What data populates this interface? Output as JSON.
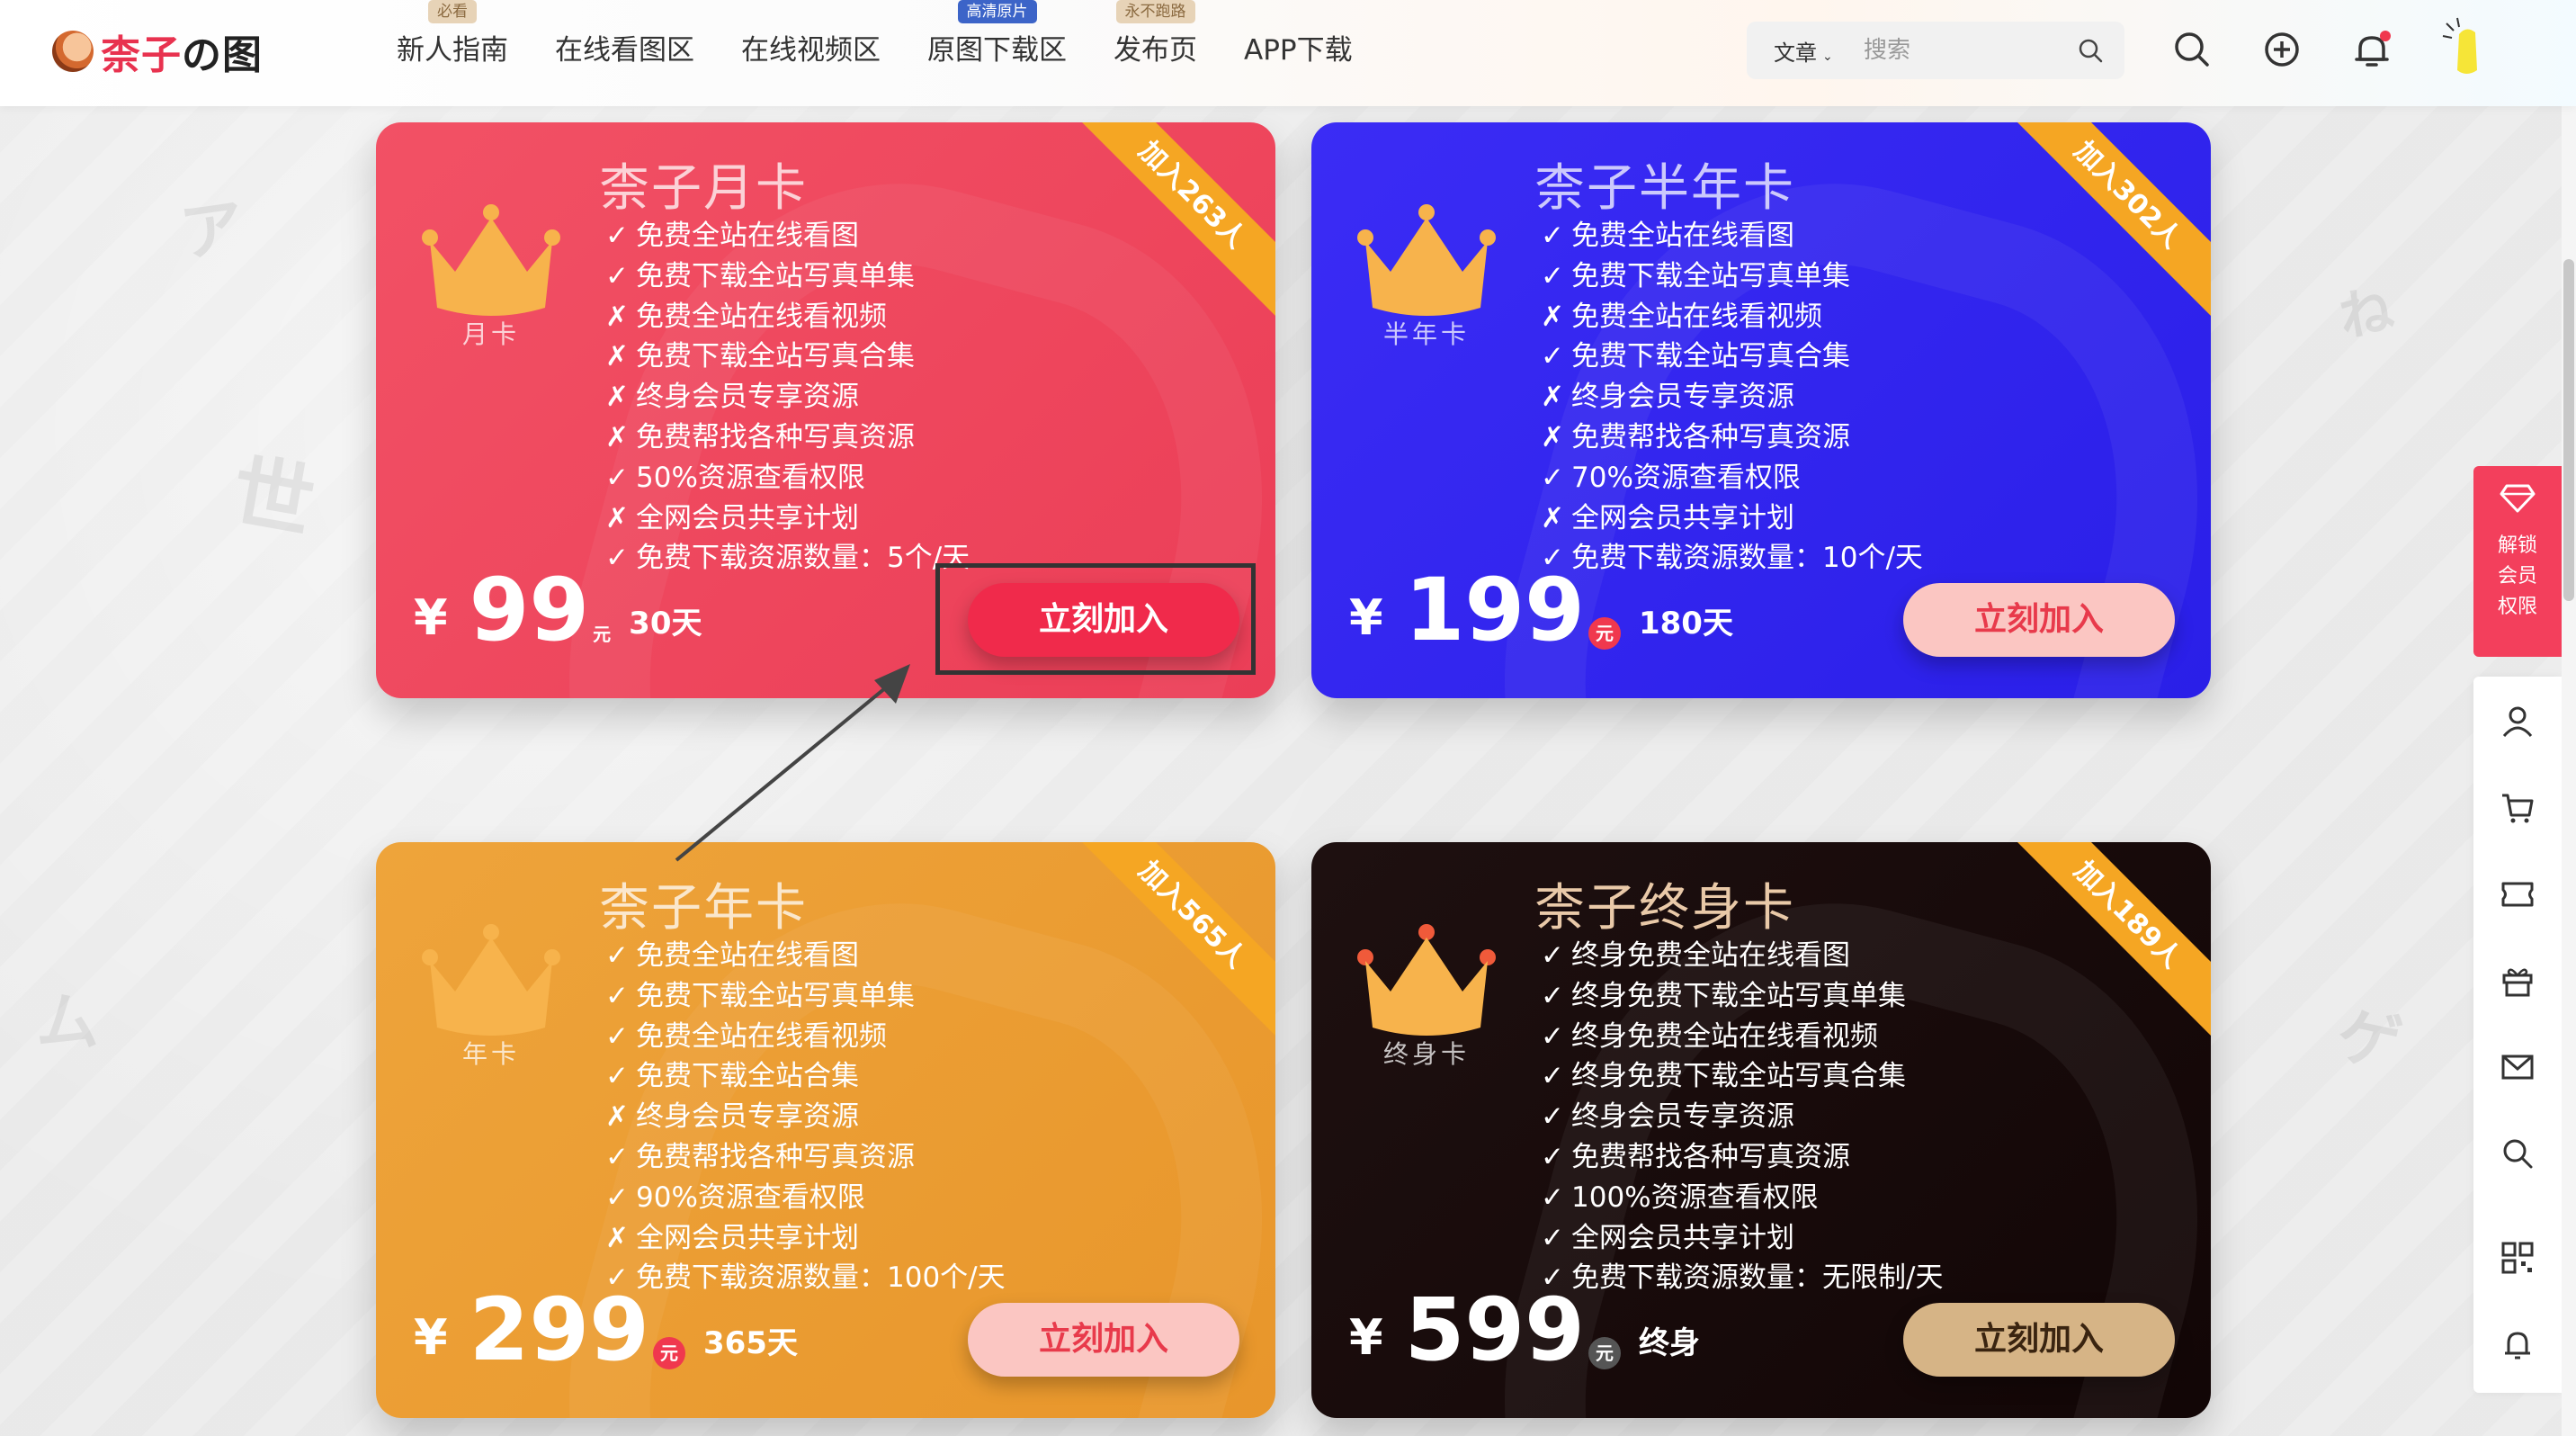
{
  "header": {
    "logo_text_red": "柰子",
    "logo_text_dark": "の图",
    "nav": [
      {
        "label": "新人指南",
        "badge": "必看",
        "badge_style": "tan"
      },
      {
        "label": "在线看图区",
        "badge": "",
        "badge_style": ""
      },
      {
        "label": "在线视频区",
        "badge": "",
        "badge_style": ""
      },
      {
        "label": "原图下载区",
        "badge": "高清原片",
        "badge_style": "blue"
      },
      {
        "label": "发布页",
        "badge": "永不跑路",
        "badge_style": "tan"
      },
      {
        "label": "APP下载",
        "badge": "",
        "badge_style": ""
      }
    ],
    "search_type": "文章",
    "search_placeholder": "搜索"
  },
  "cards": [
    {
      "title": "柰子月卡",
      "crown_label": "月卡",
      "ribbon": "加入263人",
      "features": [
        {
          "mark": "✓",
          "text": "免费全站在线看图"
        },
        {
          "mark": "✓",
          "text": "免费下载全站写真单集"
        },
        {
          "mark": "✗",
          "text": "免费全站在线看视频"
        },
        {
          "mark": "✗",
          "text": "免费下载全站写真合集"
        },
        {
          "mark": "✗",
          "text": "终身会员专享资源"
        },
        {
          "mark": "✗",
          "text": "免费帮找各种写真资源"
        },
        {
          "mark": "✓",
          "text": "50%资源查看权限"
        },
        {
          "mark": "✗",
          "text": "全网会员共享计划"
        },
        {
          "mark": "✓",
          "text": "免费下载资源数量：5个/天"
        }
      ],
      "currency": "¥",
      "price": "99",
      "unit": "元",
      "duration": "30天",
      "button": "立刻加入"
    },
    {
      "title": "柰子半年卡",
      "crown_label": "半年卡",
      "ribbon": "加入302人",
      "features": [
        {
          "mark": "✓",
          "text": "免费全站在线看图"
        },
        {
          "mark": "✓",
          "text": "免费下载全站写真单集"
        },
        {
          "mark": "✗",
          "text": "免费全站在线看视频"
        },
        {
          "mark": "✓",
          "text": "免费下载全站写真合集"
        },
        {
          "mark": "✗",
          "text": "终身会员专享资源"
        },
        {
          "mark": "✗",
          "text": "免费帮找各种写真资源"
        },
        {
          "mark": "✓",
          "text": "70%资源查看权限"
        },
        {
          "mark": "✗",
          "text": "全网会员共享计划"
        },
        {
          "mark": "✓",
          "text": "免费下载资源数量：10个/天"
        }
      ],
      "currency": "¥",
      "price": "199",
      "unit": "元",
      "duration": "180天",
      "button": "立刻加入"
    },
    {
      "title": "柰子年卡",
      "crown_label": "年卡",
      "ribbon": "加入565人",
      "features": [
        {
          "mark": "✓",
          "text": "免费全站在线看图"
        },
        {
          "mark": "✓",
          "text": "免费下载全站写真单集"
        },
        {
          "mark": "✓",
          "text": "免费全站在线看视频"
        },
        {
          "mark": "✓",
          "text": "免费下载全站合集"
        },
        {
          "mark": "✗",
          "text": "终身会员专享资源"
        },
        {
          "mark": "✓",
          "text": "免费帮找各种写真资源"
        },
        {
          "mark": "✓",
          "text": "90%资源查看权限"
        },
        {
          "mark": "✗",
          "text": "全网会员共享计划"
        },
        {
          "mark": "✓",
          "text": "免费下载资源数量：100个/天"
        }
      ],
      "currency": "¥",
      "price": "299",
      "unit": "元",
      "duration": "365天",
      "button": "立刻加入"
    },
    {
      "title": "柰子终身卡",
      "crown_label": "终身卡",
      "ribbon": "加入189人",
      "features": [
        {
          "mark": "✓",
          "text": "终身免费全站在线看图"
        },
        {
          "mark": "✓",
          "text": "终身免费下载全站写真单集"
        },
        {
          "mark": "✓",
          "text": "终身免费全站在线看视频"
        },
        {
          "mark": "✓",
          "text": "终身免费下载全站写真合集"
        },
        {
          "mark": "✓",
          "text": "终身会员专享资源"
        },
        {
          "mark": "✓",
          "text": "免费帮找各种写真资源"
        },
        {
          "mark": "✓",
          "text": "100%资源查看权限"
        },
        {
          "mark": "✓",
          "text": "全网会员共享计划"
        },
        {
          "mark": "✓",
          "text": "免费下载资源数量：无限制/天"
        }
      ],
      "currency": "¥",
      "price": "599",
      "unit": "元",
      "duration": "终身",
      "button": "立刻加入"
    }
  ],
  "sidebar": {
    "vip_label": "解锁会员权限",
    "icons": [
      "user-icon",
      "cart-icon",
      "ticket-icon",
      "gift-icon",
      "mail-icon",
      "search-icon",
      "qrcode-icon",
      "bell-icon"
    ]
  },
  "colors": {
    "red_card": "#eb3e57",
    "blue_card": "#2a1fe8",
    "orange_card": "#e8962b",
    "black_card": "#120606",
    "ribbon": "#f5a623",
    "accent": "#f33f5c"
  }
}
